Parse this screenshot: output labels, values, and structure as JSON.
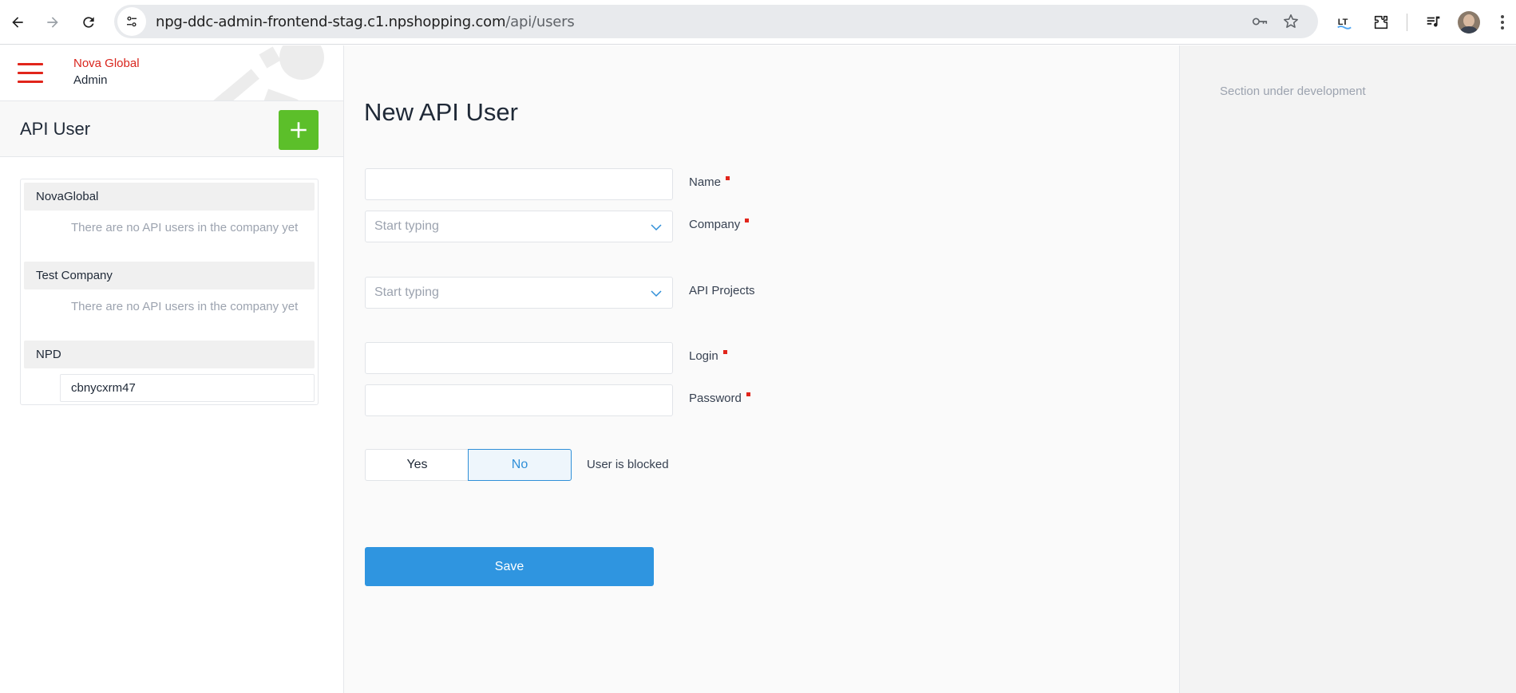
{
  "browser": {
    "url_host": "npg-ddc-admin-frontend-stag.c1.npshopping.com",
    "url_path": "/api/users",
    "extension_label": "LT"
  },
  "brand": {
    "name": "Nova Global",
    "role": "Admin",
    "accent_color": "#e1251b"
  },
  "list": {
    "title": "API User",
    "add_button_color": "#5cbf2a",
    "companies": [
      {
        "name": "NovaGlobal",
        "empty_note": "There are no API users in the company yet"
      },
      {
        "name": "Test Company",
        "empty_note": "There are no API users in the company yet"
      },
      {
        "name": "NPD",
        "users": [
          "cbnycxrm47"
        ]
      }
    ]
  },
  "form": {
    "title": "New API User",
    "name": {
      "label": "Name",
      "value": "",
      "required": true
    },
    "company": {
      "label": "Company",
      "placeholder": "Start typing",
      "required": true
    },
    "api_projects": {
      "label": "API Projects",
      "placeholder": "Start typing",
      "required": false
    },
    "login": {
      "label": "Login",
      "value": "",
      "required": true
    },
    "password": {
      "label": "Password",
      "value": "",
      "required": true
    },
    "blocked": {
      "label": "User is blocked",
      "yes_label": "Yes",
      "no_label": "No",
      "selected": "No"
    },
    "save_label": "Save",
    "primary_color": "#2f95e0"
  },
  "side": {
    "dev_note": "Section under development"
  }
}
